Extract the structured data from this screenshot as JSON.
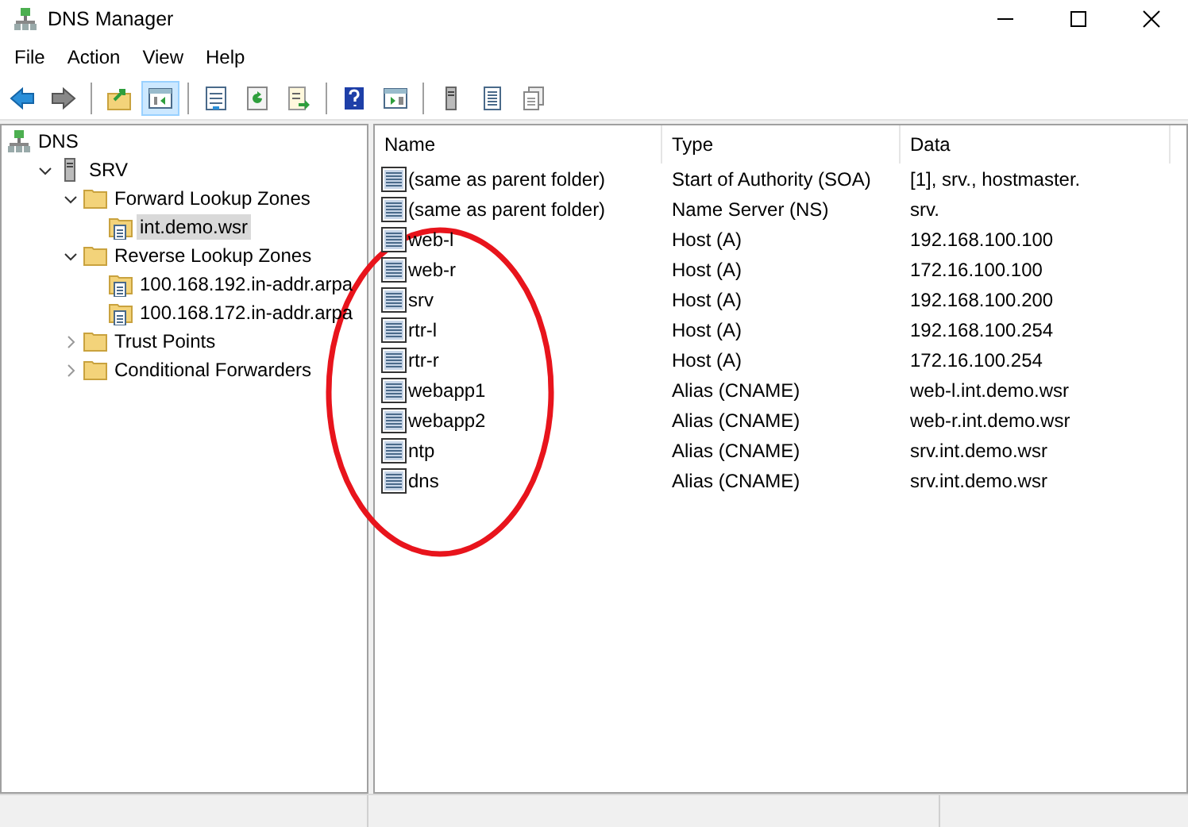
{
  "window": {
    "title": "DNS Manager"
  },
  "menu": [
    "File",
    "Action",
    "View",
    "Help"
  ],
  "toolbar": [
    {
      "kind": "back",
      "pressed": false
    },
    {
      "kind": "forward",
      "pressed": false
    },
    {
      "kind": "sep"
    },
    {
      "kind": "up",
      "pressed": false
    },
    {
      "kind": "tree",
      "pressed": true
    },
    {
      "kind": "sep"
    },
    {
      "kind": "props",
      "pressed": false
    },
    {
      "kind": "refresh",
      "pressed": false
    },
    {
      "kind": "export",
      "pressed": false
    },
    {
      "kind": "sep"
    },
    {
      "kind": "help",
      "pressed": false
    },
    {
      "kind": "pane",
      "pressed": false
    },
    {
      "kind": "sep"
    },
    {
      "kind": "server",
      "pressed": false
    },
    {
      "kind": "list",
      "pressed": false
    },
    {
      "kind": "copy",
      "pressed": false
    }
  ],
  "tree": [
    {
      "label": "DNS",
      "kind": "dns",
      "selected": false,
      "children": [
        {
          "label": "SRV",
          "kind": "server",
          "expanded": true,
          "selected": false,
          "children": [
            {
              "label": "Forward Lookup Zones",
              "kind": "folder",
              "expanded": true,
              "selected": false,
              "children": [
                {
                  "label": "int.demo.wsr",
                  "kind": "zone",
                  "selected": true
                }
              ]
            },
            {
              "label": "Reverse Lookup Zones",
              "kind": "folder",
              "expanded": true,
              "selected": false,
              "children": [
                {
                  "label": "100.168.192.in-addr.arpa",
                  "kind": "zone",
                  "selected": false
                },
                {
                  "label": "100.168.172.in-addr.arpa",
                  "kind": "zone",
                  "selected": false
                }
              ]
            },
            {
              "label": "Trust Points",
              "kind": "folder",
              "expanded": false,
              "selected": false
            },
            {
              "label": "Conditional Forwarders",
              "kind": "folder",
              "expanded": false,
              "selected": false
            }
          ]
        }
      ]
    }
  ],
  "table": {
    "columns": [
      "Name",
      "Type",
      "Data"
    ],
    "rows": [
      [
        "(same as parent folder)",
        "Start of Authority (SOA)",
        "[1], srv., hostmaster."
      ],
      [
        "(same as parent folder)",
        "Name Server (NS)",
        "srv."
      ],
      [
        "web-l",
        "Host (A)",
        "192.168.100.100"
      ],
      [
        "web-r",
        "Host (A)",
        "172.16.100.100"
      ],
      [
        "srv",
        "Host (A)",
        "192.168.100.200"
      ],
      [
        "rtr-l",
        "Host (A)",
        "192.168.100.254"
      ],
      [
        "rtr-r",
        "Host (A)",
        "172.16.100.254"
      ],
      [
        "webapp1",
        "Alias (CNAME)",
        "web-l.int.demo.wsr"
      ],
      [
        "webapp2",
        "Alias (CNAME)",
        "web-r.int.demo.wsr"
      ],
      [
        "ntp",
        "Alias (CNAME)",
        "srv.int.demo.wsr"
      ],
      [
        "dns",
        "Alias (CNAME)",
        "srv.int.demo.wsr"
      ]
    ]
  },
  "annotation": {
    "kind": "ellipse",
    "color": "#e8141c"
  }
}
